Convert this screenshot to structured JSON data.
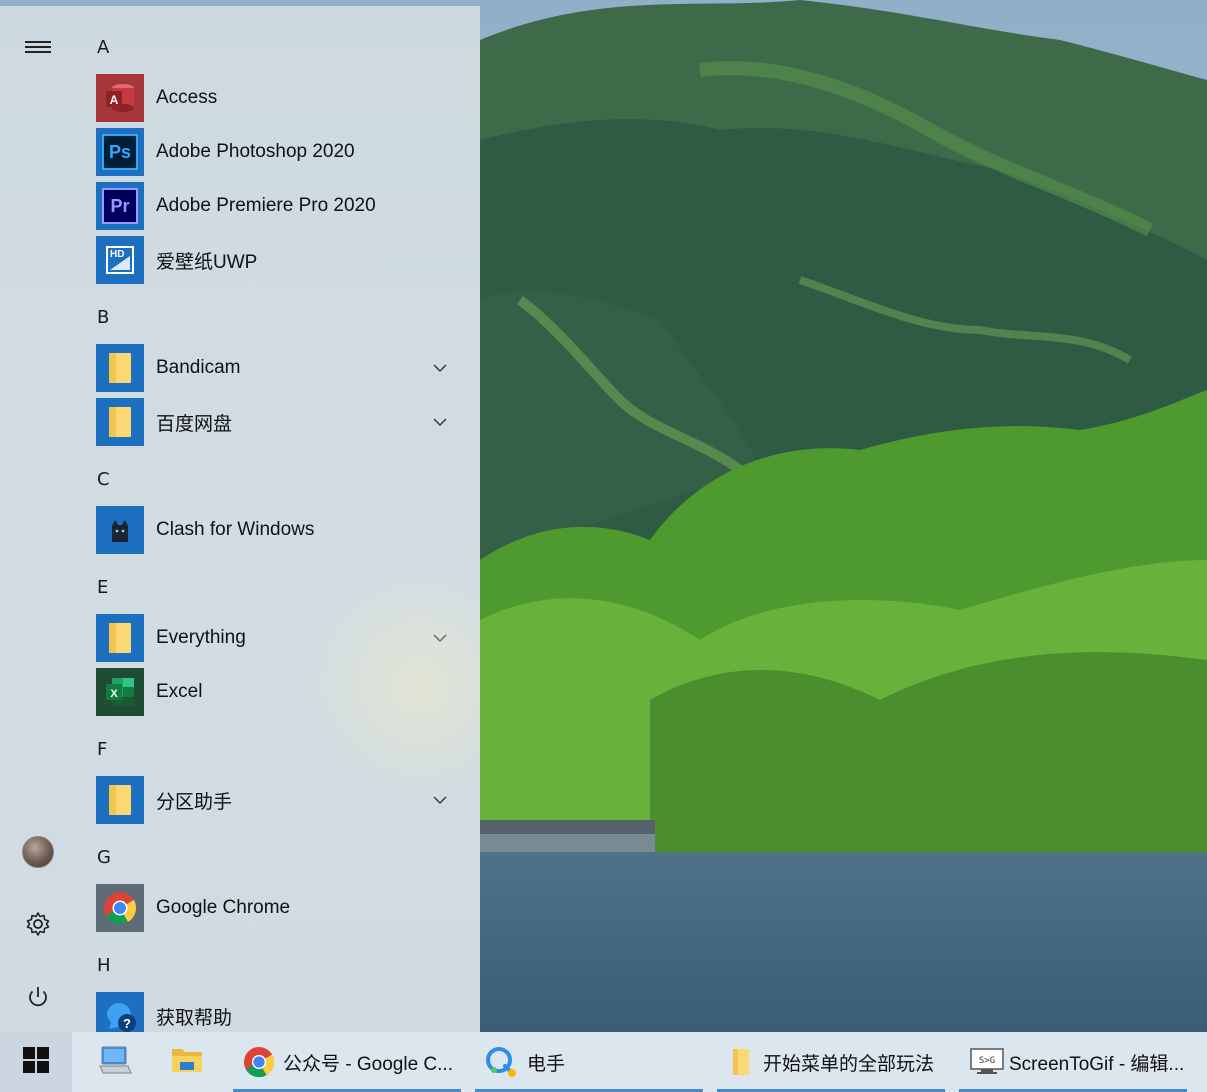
{
  "rail": {
    "menu_icon": "hamburger-icon",
    "user_icon": "avatar",
    "settings_icon": "gear-icon",
    "power_icon": "power-icon"
  },
  "groups": {
    "A": "A",
    "B": "B",
    "C": "C",
    "E": "E",
    "F": "F",
    "G": "G",
    "H": "H"
  },
  "apps": {
    "access": "Access",
    "photoshop": "Adobe Photoshop 2020",
    "premiere": "Adobe Premiere Pro 2020",
    "wallpaper": "爱壁纸UWP",
    "bandicam": "Bandicam",
    "baidu": "百度网盘",
    "clash": "Clash for Windows",
    "everything": "Everything",
    "excel": "Excel",
    "partition": "分区助手",
    "chrome": "Google Chrome",
    "help": "获取帮助"
  },
  "tile_text": {
    "access": "A",
    "photoshop": "Ps",
    "premiere": "Pr",
    "wallpaper": "HD",
    "excel": "X",
    "help": "?"
  },
  "taskbar": {
    "start_icon": "windows-logo-icon",
    "pinned": [
      "this-pc-icon",
      "file-explorer-icon"
    ],
    "tasks": {
      "chrome": "公众号 - Google C...",
      "app": "电手",
      "folder": "开始菜单的全部玩法",
      "screentogif": "ScreenToGif - 编辑..."
    }
  },
  "colors": {
    "menu_bg": "#d0dbe1",
    "accent": "#1d6fbf",
    "taskbar_bg": "#dbe6ef",
    "active_underline": "#4b8ac7"
  }
}
